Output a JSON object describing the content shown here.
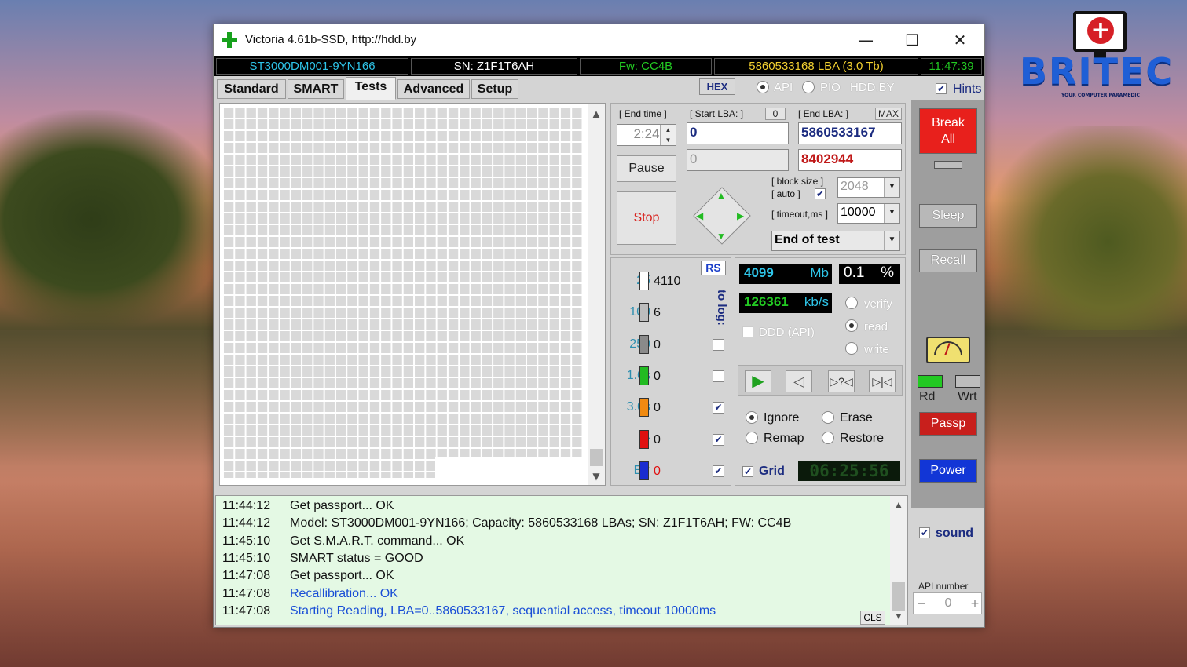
{
  "window": {
    "title": "Victoria 4.61b-SSD, http://hdd.by",
    "controls": {
      "minimize": "—",
      "maximize": "☐",
      "close": "✕"
    }
  },
  "info_bar": {
    "model": "ST3000DM001-9YN166",
    "serial": "SN: Z1F1T6AH",
    "firmware": "Fw: CC4B",
    "capacity": "5860533168 LBA (3.0 Tb)",
    "clock": "11:47:39"
  },
  "tabs": [
    "Standard",
    "SMART",
    "Tests",
    "Advanced",
    "Setup"
  ],
  "active_tab": "Tests",
  "top_options": {
    "hex": "HEX",
    "api": "API",
    "pio": "PIO",
    "hddby": "HDD.BY",
    "hints": "Hints"
  },
  "test_controls": {
    "end_time_label": "[ End time ]",
    "end_time_value": "2:24",
    "start_lba_label": "[ Start LBA: ]",
    "start_lba_zero": "0",
    "start_lba_value": "0",
    "current_lba": "0",
    "end_lba_label": "[ End LBA: ]",
    "end_lba_max": "MAX",
    "end_lba_value": "5860533167",
    "end_lba_current": "8402944",
    "pause": "Pause",
    "stop": "Stop",
    "block_size_label": "[ block size ]",
    "block_auto_label": "[ auto ]",
    "block_size_value": "2048",
    "timeout_label": "[ timeout,ms ]",
    "timeout_value": "10000",
    "end_action": "End of test"
  },
  "legend": {
    "rs": "RS",
    "to_log": "to log:",
    "rows": [
      {
        "label": "25",
        "count": "4110",
        "color": "#ffffff",
        "checked": ""
      },
      {
        "label": "100",
        "count": "6",
        "color": "#bdbdbd",
        "checked": ""
      },
      {
        "label": "250",
        "count": "0",
        "color": "#8a8a8a",
        "checked": ""
      },
      {
        "label": "1.0s",
        "count": "0",
        "color": "#22bb22",
        "checked": ""
      },
      {
        "label": "3.0s",
        "count": "0",
        "color": "#f08a10",
        "checked": "✔"
      },
      {
        "label": ">",
        "count": "0",
        "color": "#e01010",
        "checked": "✔"
      },
      {
        "label": "Err",
        "count": "0",
        "color": "#1a2cd0",
        "checked": "✔"
      }
    ]
  },
  "stats": {
    "mb": "4099",
    "mb_unit": "Mb",
    "percent": "0.1",
    "percent_unit": "%",
    "speed": "126361",
    "speed_unit": "kb/s",
    "ddd": "DDD (API)",
    "verify": "verify",
    "read": "read",
    "write": "write",
    "ignore": "Ignore",
    "erase": "Erase",
    "remap": "Remap",
    "restore": "Restore",
    "grid": "Grid",
    "timer": "06:25:56"
  },
  "sidebar": {
    "break_all": "Break All",
    "sleep": "Sleep",
    "recall": "Recall",
    "rd": "Rd",
    "wrt": "Wrt",
    "passp": "Passp",
    "power": "Power",
    "sound": "sound",
    "api_number_label": "API number",
    "api_number": "0",
    "minus": "−",
    "plus": "+"
  },
  "log": {
    "cls": "CLS",
    "lines": [
      {
        "time": "11:44:12",
        "text": "Get passport... OK",
        "color": "#111111"
      },
      {
        "time": "11:44:12",
        "text": "Model: ST3000DM001-9YN166; Capacity: 5860533168 LBAs; SN: Z1F1T6AH; FW: CC4B",
        "color": "#111111"
      },
      {
        "time": "11:45:10",
        "text": "Get S.M.A.R.T. command... OK",
        "color": "#111111"
      },
      {
        "time": "11:45:10",
        "text": "SMART status = GOOD",
        "color": "#111111"
      },
      {
        "time": "11:47:08",
        "text": "Get passport... OK",
        "color": "#111111"
      },
      {
        "time": "11:47:08",
        "text": "Recallibration... OK",
        "color": "#1a4fd6"
      },
      {
        "time": "11:47:08",
        "text": "Starting Reading, LBA=0..5860533167, sequential access, timeout 10000ms",
        "color": "#1a4fd6"
      }
    ]
  },
  "watermark": {
    "brand": "BRITEC",
    "tagline": "YOUR COMPUTER PARAMEDIC"
  },
  "colors": {
    "accent_red": "#e8201c",
    "accent_blue": "#1236d6",
    "info_cyan": "#2ec4e8",
    "info_yellow": "#f2d030",
    "info_green": "#22c922",
    "log_bg": "#e4f9e4"
  }
}
